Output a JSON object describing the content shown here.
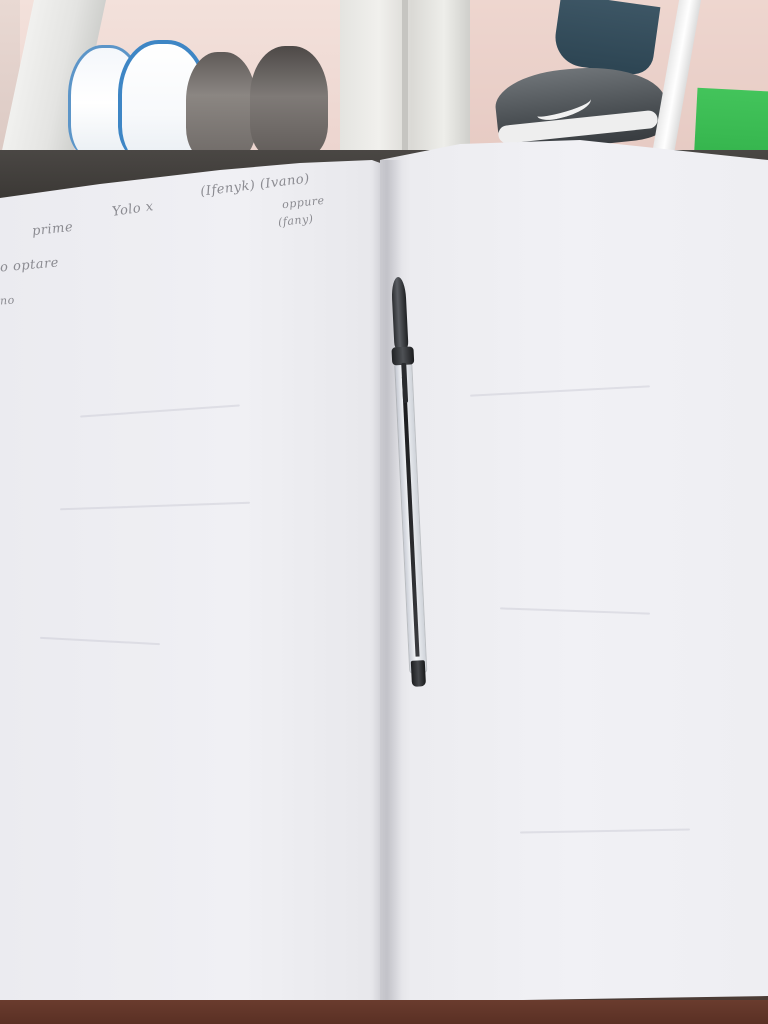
{
  "scene": {
    "description_objects": [
      "sneakers",
      "window",
      "open-notebook",
      "ballpoint-pen",
      "green-book"
    ],
    "colors": {
      "paper": "#f0f0f4",
      "pen_cap": "#2b2d30",
      "green_book": "#37b94f",
      "table": "#5a3024"
    }
  },
  "notebook": {
    "left_page": {
      "handwriting": [
        {
          "text": "prime"
        },
        {
          "text": "Yolo x"
        },
        {
          "text": "(Ifenyk) (Ivano)"
        },
        {
          "text": "oppure"
        },
        {
          "text": "(fany)"
        },
        {
          "text": "o optare"
        },
        {
          "text": "no"
        }
      ]
    },
    "right_page": {
      "handwriting": []
    }
  }
}
